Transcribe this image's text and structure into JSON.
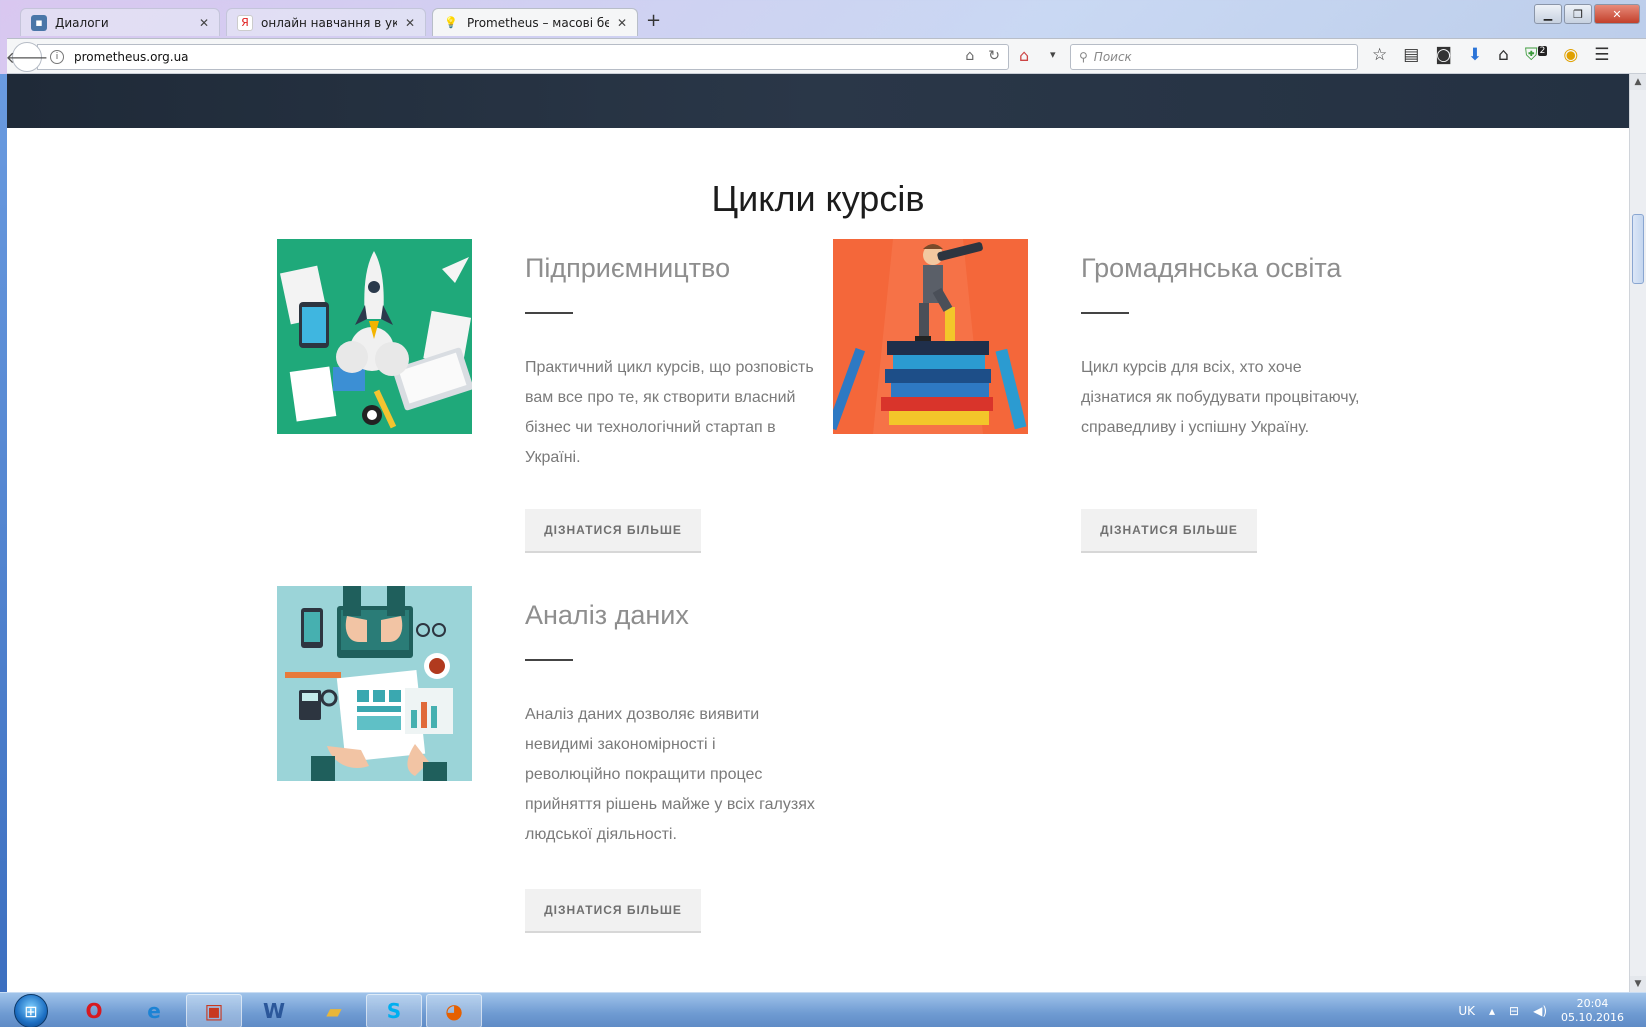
{
  "browser": {
    "tabs": [
      {
        "title": "Диалоги",
        "favicon": "chat-icon"
      },
      {
        "title": "онлайн навчання в украін...",
        "favicon": "yandex-icon"
      },
      {
        "title": "Prometheus – масові безк...",
        "favicon": "bulb-icon",
        "active": true
      }
    ],
    "url": "prometheus.org.ua",
    "search_placeholder": "Поиск",
    "badge_count": "2"
  },
  "page": {
    "section_title": "Цикли курсів",
    "cards": [
      {
        "title": "Підприємництво",
        "description": "Практичний цикл курсів, що розповість вам все про те, як створити власний бізнес чи технологічний стартап в Україні.",
        "button": "ДІЗНАТИСЯ БІЛЬШЕ",
        "image": "startup-illustration",
        "image_bg": "#1fa97a"
      },
      {
        "title": "Громадянська освіта",
        "description": "Цикл курсів для всіх, хто хоче дізнатися як побудувати процвітаючу, справедливу і успішну Україну.",
        "button": "ДІЗНАТИСЯ БІЛЬШЕ",
        "image": "books-telescope-illustration",
        "image_bg": "#f4673a"
      },
      {
        "title": "Аналіз даних",
        "description": "Аналіз даних дозволяє виявити невидимі закономірності і революційно покращити процес прийняття рішень майже у всіх галузях людської діяльності.",
        "button": "ДІЗНАТИСЯ БІЛЬШЕ",
        "image": "data-analysis-illustration",
        "image_bg": "#9bd4d8"
      }
    ]
  },
  "taskbar": {
    "language": "UK",
    "time": "20:04",
    "date": "05.10.2016"
  }
}
